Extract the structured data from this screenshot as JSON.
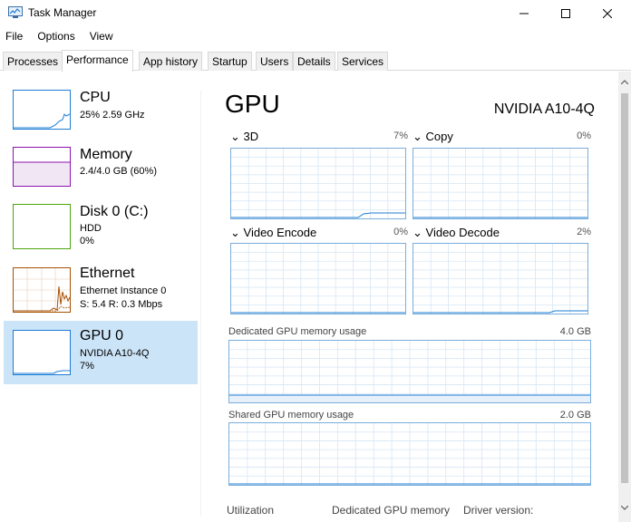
{
  "window": {
    "title": "Task Manager",
    "controls": [
      "minimize",
      "maximize",
      "close"
    ]
  },
  "menu": [
    "File",
    "Options",
    "View"
  ],
  "tabs": [
    "Processes",
    "Performance",
    "App history",
    "Startup",
    "Users",
    "Details",
    "Services"
  ],
  "active_tab": "Performance",
  "sidebar": [
    {
      "title": "CPU",
      "line1": "25%  2.59 GHz",
      "line2": "",
      "color": "#1c7cd5"
    },
    {
      "title": "Memory",
      "line1": "2.4/4.0 GB (60%)",
      "line2": "",
      "color": "#8b12ae"
    },
    {
      "title": "Disk 0 (C:)",
      "line1": "HDD",
      "line2": "0%",
      "color": "#4da60c"
    },
    {
      "title": "Ethernet",
      "line1": "Ethernet Instance 0",
      "line2": "S: 5.4  R: 0.3 Mbps",
      "color": "#a74f01"
    },
    {
      "title": "GPU 0",
      "line1": "NVIDIA A10-4Q",
      "line2": "7%",
      "color": "#1c7cd5"
    }
  ],
  "main": {
    "title": "GPU",
    "model": "NVIDIA A10-4Q",
    "engines": [
      {
        "name": "3D",
        "value": "7%"
      },
      {
        "name": "Copy",
        "value": "0%"
      },
      {
        "name": "Video Encode",
        "value": "0%"
      },
      {
        "name": "Video Decode",
        "value": "2%"
      }
    ],
    "dedicated_memory": {
      "label": "Dedicated GPU memory usage",
      "max": "4.0 GB"
    },
    "shared_memory": {
      "label": "Shared GPU memory usage",
      "max": "2.0 GB"
    },
    "bottom_labels": [
      "Utilization",
      "Dedicated GPU memory",
      "Driver version:"
    ]
  },
  "graph_color": "#1c7cd5"
}
